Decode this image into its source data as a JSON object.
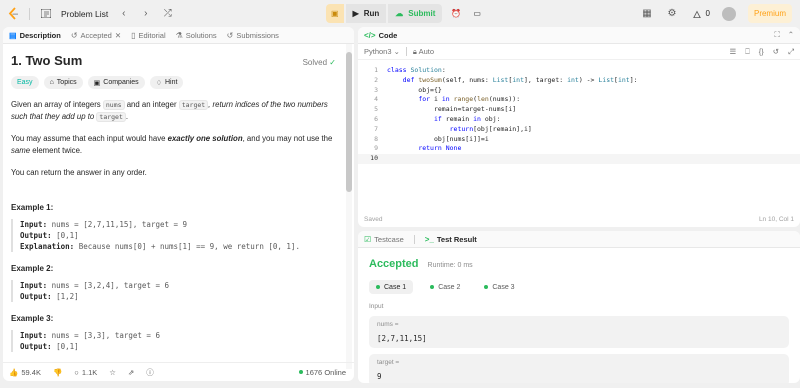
{
  "topbar": {
    "problem_list": "Problem List",
    "run": "Run",
    "submit": "Submit",
    "streak": "0",
    "premium": "Premium"
  },
  "left_tabs": [
    {
      "label": "Description",
      "icon": "description-icon"
    },
    {
      "label": "Accepted",
      "icon": "history-icon"
    },
    {
      "label": "Editorial",
      "icon": "book-icon"
    },
    {
      "label": "Solutions",
      "icon": "flask-icon"
    },
    {
      "label": "Submissions",
      "icon": "history-icon"
    }
  ],
  "problem": {
    "title": "1. Two Sum",
    "status": "Solved",
    "difficulty": "Easy",
    "topics": "Topics",
    "companies": "Companies",
    "hint": "Hint",
    "p1_a": "Given an array of integers ",
    "p1_code1": "nums",
    "p1_b": " and an integer ",
    "p1_code2": "target",
    "p1_c": ", return indices of the two numbers such that they add up to ",
    "p1_code3": "target",
    "p1_d": ".",
    "p2_a": "You may assume that each input would have ",
    "p2_bold": "exactly one solution",
    "p2_b": ", and you may not use the ",
    "p2_em": "same",
    "p2_c": " element twice.",
    "p3": "You can return the answer in any order.",
    "examples": [
      {
        "heading": "Example 1:",
        "input": "nums = [2,7,11,15], target = 9",
        "output": "[0,1]",
        "explanation": "Because nums[0] + nums[1] == 9, we return [0, 1]."
      },
      {
        "heading": "Example 2:",
        "input": "nums = [3,2,4], target = 6",
        "output": "[1,2]"
      },
      {
        "heading": "Example 3:",
        "input": "nums = [3,3], target = 6",
        "output": "[0,1]"
      }
    ],
    "labels": {
      "input": "Input:",
      "output": "Output:",
      "explanation": "Explanation:"
    }
  },
  "footer": {
    "likes": "59.4K",
    "comments": "1.1K",
    "online": "1676 Online"
  },
  "code_panel": {
    "tab": "Code",
    "language": "Python3",
    "auto": "Auto",
    "status_left": "Saved",
    "status_right": "Ln 10, Col 1",
    "lines": [
      "1",
      "2",
      "3",
      "4",
      "5",
      "6",
      "7",
      "8",
      "9",
      "10"
    ]
  },
  "result_panel": {
    "tab_testcase": "Testcase",
    "tab_result": "Test Result",
    "verdict": "Accepted",
    "runtime": "Runtime: 0 ms",
    "cases": [
      "Case 1",
      "Case 2",
      "Case 3"
    ],
    "input_label": "Input",
    "params": [
      {
        "name": "nums =",
        "value": "[2,7,11,15]"
      },
      {
        "name": "target =",
        "value": "9"
      }
    ]
  },
  "colors": {
    "accent": "#ffa116",
    "success": "#2cbb5d",
    "easy": "#00b8a3"
  }
}
